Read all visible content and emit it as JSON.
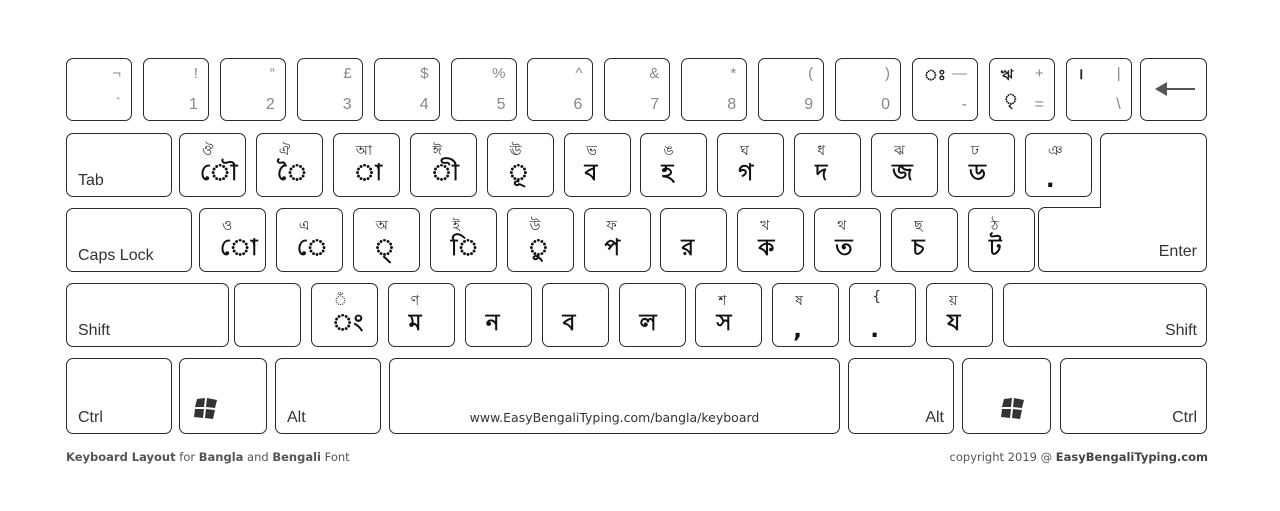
{
  "number_row": [
    {
      "shift": "¬",
      "base": "`"
    },
    {
      "shift": "!",
      "base": "1"
    },
    {
      "shift": "“",
      "base": "2"
    },
    {
      "shift": "£",
      "base": "3"
    },
    {
      "shift": "$",
      "base": "4"
    },
    {
      "shift": "%",
      "base": "5"
    },
    {
      "shift": "^",
      "base": "6"
    },
    {
      "shift": "&",
      "base": "7"
    },
    {
      "shift": "*",
      "base": "8"
    },
    {
      "shift": "(",
      "base": "9"
    },
    {
      "shift": ")",
      "base": "0"
    },
    {
      "bn_shift": "ঃ",
      "shift": "—",
      "bn_base": "",
      "base": "-"
    },
    {
      "bn_shift": "ঋ",
      "shift": "+",
      "bn_base": "ৃ",
      "base": "="
    },
    {
      "bn_shift": "।",
      "shift": "|",
      "bn_base": "",
      "base": "\\"
    }
  ],
  "backspace_icon": "left-arrow-icon",
  "top_row": {
    "tab_label": "Tab",
    "keys": [
      {
        "shift": "ঔ",
        "base": "ৌ"
      },
      {
        "shift": "ঐ",
        "base": "ৈ"
      },
      {
        "shift": "আ",
        "base": "া"
      },
      {
        "shift": "ঈ",
        "base": "ী"
      },
      {
        "shift": "ঊ",
        "base": "ূ"
      },
      {
        "shift": "ভ",
        "base": "ব"
      },
      {
        "shift": "ঙ",
        "base": "হ"
      },
      {
        "shift": "ঘ",
        "base": "গ"
      },
      {
        "shift": "ধ",
        "base": "দ"
      },
      {
        "shift": "ঝ",
        "base": "জ"
      },
      {
        "shift": "ঢ",
        "base": "ড"
      },
      {
        "shift": "ঞ",
        "base": "."
      }
    ]
  },
  "home_row": {
    "caps_label": "Caps Lock",
    "enter_label": "Enter",
    "keys": [
      {
        "shift": "ও",
        "base": "ো"
      },
      {
        "shift": "এ",
        "base": "ে"
      },
      {
        "shift": "অ",
        "base": "্"
      },
      {
        "shift": "ই",
        "base": "ি"
      },
      {
        "shift": "উ",
        "base": "ু"
      },
      {
        "shift": "ফ",
        "base": "প"
      },
      {
        "shift": "",
        "base": "র"
      },
      {
        "shift": "খ",
        "base": "ক"
      },
      {
        "shift": "থ",
        "base": "ত"
      },
      {
        "shift": "ছ",
        "base": "চ"
      },
      {
        "shift": "ঠ",
        "base": "ট"
      }
    ]
  },
  "bottom_row": {
    "shift_left_label": "Shift",
    "shift_right_label": "Shift",
    "keys": [
      {
        "shift": "",
        "base": ""
      },
      {
        "shift": "ঁ",
        "base": "ং"
      },
      {
        "shift": "ণ",
        "base": "ম"
      },
      {
        "shift": "",
        "base": "ন"
      },
      {
        "shift": "",
        "base": "ব"
      },
      {
        "shift": "",
        "base": "ল"
      },
      {
        "shift": "শ",
        "base": "স"
      },
      {
        "shift": "ষ",
        "base": ","
      },
      {
        "shift": "{",
        "base": "."
      },
      {
        "shift": "য়",
        "base": "য"
      }
    ]
  },
  "space_row": {
    "ctrl_left": "Ctrl",
    "alt_left": "Alt",
    "space_text": "www.EasyBengaliTyping.com/bangla/keyboard",
    "alt_right": "Alt",
    "ctrl_right": "Ctrl",
    "win_icon": "windows-logo-icon"
  },
  "footer": {
    "left_parts": [
      {
        "text": "Keyboard Layout",
        "bold": true
      },
      {
        "text": " for ",
        "bold": false
      },
      {
        "text": "Bangla",
        "bold": true
      },
      {
        "text": " and ",
        "bold": false
      },
      {
        "text": "Bengali",
        "bold": true
      },
      {
        "text": " Font",
        "bold": false
      }
    ],
    "right_prefix": "copyright 2019 @ ",
    "right_brand": "EasyBengaliTyping.com"
  }
}
